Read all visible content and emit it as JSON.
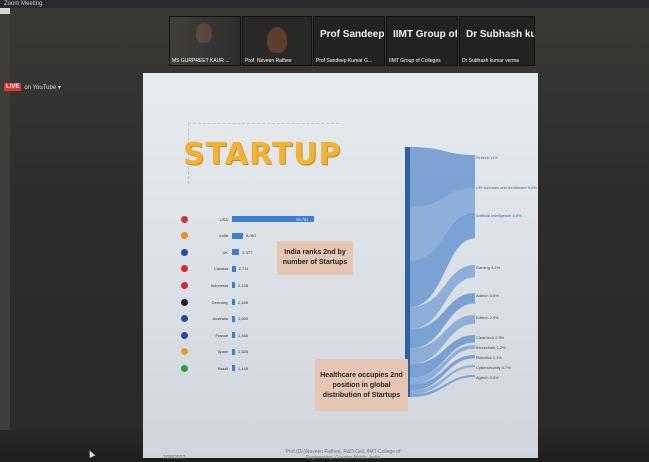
{
  "window": {
    "title": "Zoom Meeting"
  },
  "stream": {
    "live_label": "LIVE",
    "destination": "on YouTube ▾"
  },
  "participants": [
    {
      "name": "MS GURPREET KAUR ..."
    },
    {
      "name": "Prof. Naveen Rathee"
    },
    {
      "display": "Prof Sandeep K...",
      "name": "Prof Sandeep Kumar G..."
    },
    {
      "display": "IIMT Group of C...",
      "name": "IIMT Group of Colleges"
    },
    {
      "display": "Dr Subhash ku...",
      "name": "Dr Subhash kumar verma"
    }
  ],
  "slide": {
    "title": "STARTUP",
    "callout_india": "India ranks 2nd by number of Startups",
    "callout_health": "Healthcare occupies 2nd position in global distribution of Startups",
    "date": "2/28/2022",
    "credit": "Prof.(Dr.)Naveen Rathee, R&D Cell, IIMT College of Engineering, Greater Noida, India",
    "countries": [
      {
        "name": "USA",
        "value": "59,761",
        "fraction": 1.0,
        "color": "#c23b3b"
      },
      {
        "name": "India",
        "value": "8,061",
        "fraction": 0.135,
        "color": "#f08a24"
      },
      {
        "name": "UK",
        "value": "5,377",
        "fraction": 0.09,
        "color": "#2b4a9a"
      },
      {
        "name": "Canada",
        "value": "2,711",
        "fraction": 0.045,
        "color": "#d42a2a"
      },
      {
        "name": "Indonesia",
        "value": "2,196",
        "fraction": 0.037,
        "color": "#d42a2a"
      },
      {
        "name": "Germany",
        "value": "2,158",
        "fraction": 0.036,
        "color": "#222222"
      },
      {
        "name": "Australia",
        "value": "1,653",
        "fraction": 0.028,
        "color": "#2b4a9a"
      },
      {
        "name": "France",
        "value": "1,460",
        "fraction": 0.024,
        "color": "#2b4a9a"
      },
      {
        "name": "Spain",
        "value": "1,326",
        "fraction": 0.022,
        "color": "#e0a020"
      },
      {
        "name": "Brazil",
        "value": "1,149",
        "fraction": 0.019,
        "color": "#2b9a4a"
      }
    ],
    "sectors": [
      {
        "name": "Fintech",
        "value": "11%"
      },
      {
        "name": "Life sciences and healthcare",
        "value": "9.8%"
      },
      {
        "name": "Artificial Intelligence",
        "value": "8.5%"
      },
      {
        "name": "Gaming",
        "value": "4.1%"
      },
      {
        "name": "Adtech",
        "value": "3.5%"
      },
      {
        "name": "Edtech",
        "value": "2.9%"
      },
      {
        "name": "Cleantech",
        "value": "2.5%"
      },
      {
        "name": "Blockchain",
        "value": "1.2%"
      },
      {
        "name": "Robotics",
        "value": "1.1%"
      },
      {
        "name": "Cybersecurity",
        "value": "0.7%"
      },
      {
        "name": "Agtech",
        "value": "0.5%"
      }
    ]
  }
}
